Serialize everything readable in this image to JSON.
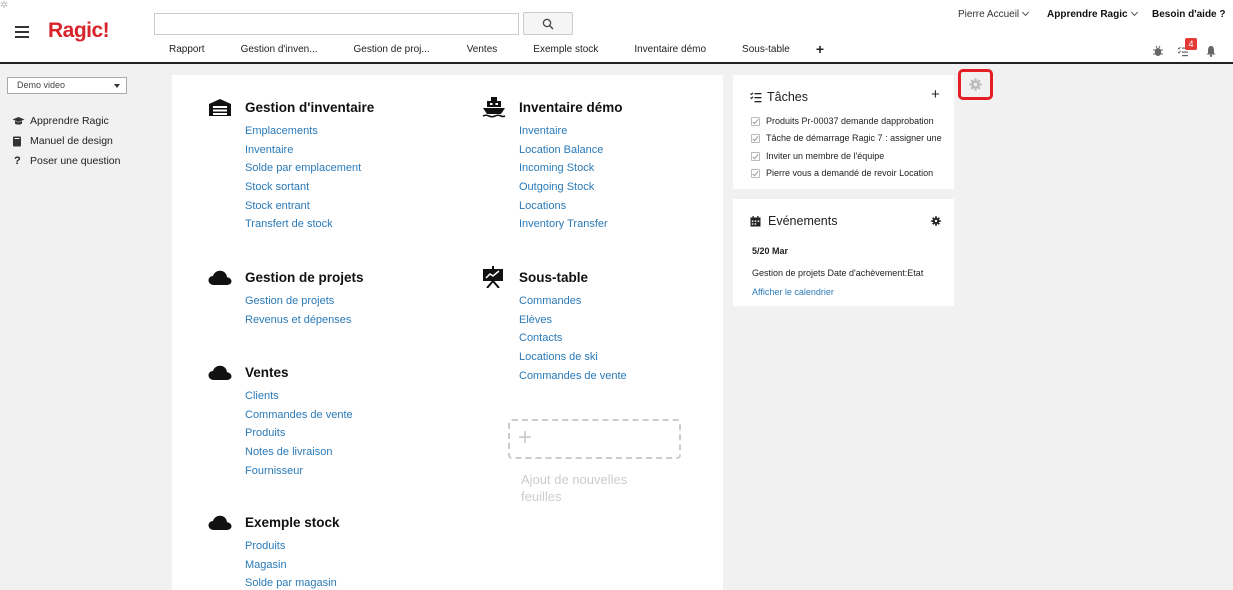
{
  "app": {
    "logo": "Ragic!"
  },
  "search": {
    "placeholder": ""
  },
  "nav_tabs": [
    "Rapport",
    "Gestion d'inven...",
    "Gestion de proj...",
    "Ventes",
    "Exemple stock",
    "Inventaire démo",
    "Sous-table"
  ],
  "nav_add": "+",
  "user_menu": {
    "account": "Pierre Accueil",
    "learn": "Apprendre Ragic",
    "help": "Besoin d'aide ?"
  },
  "notifications": {
    "todo_count": "4"
  },
  "sidebar": {
    "db_select": "Demo video",
    "links": [
      "Apprendre Ragic",
      "Manuel de design",
      "Poser une question"
    ]
  },
  "groups": [
    {
      "title": "Gestion d'inventaire",
      "items": [
        "Emplacements",
        "Inventaire",
        "Solde par emplacement",
        "Stock sortant",
        "Stock entrant",
        "Transfert de stock"
      ]
    },
    {
      "title": "Gestion de projets",
      "items": [
        "Gestion de projets",
        "Revenus et dépenses"
      ]
    },
    {
      "title": "Ventes",
      "items": [
        "Clients",
        "Commandes de vente",
        "Produits",
        "Notes de livraison",
        "Fournisseur"
      ]
    },
    {
      "title": "Exemple stock",
      "items": [
        "Produits",
        "Magasin",
        "Solde par magasin"
      ]
    },
    {
      "title": "Inventaire démo",
      "items": [
        "Inventaire",
        "Location Balance",
        "Incoming Stock",
        "Outgoing Stock",
        "Locations",
        "Inventory Transfer"
      ]
    },
    {
      "title": "Sous-table",
      "items": [
        "Commandes",
        "Elèves",
        "Contacts",
        "Locations de ski",
        "Commandes de vente"
      ]
    }
  ],
  "add_sheet": {
    "label": "Ajout de nouvelles feuilles"
  },
  "tasks": {
    "title": "Tâches",
    "items": [
      "Produits Pr-00037 demande dapprobation",
      "Tâche de démarrage Ragic 7 : assigner une",
      "Inviter un membre de l'équipe",
      "Pierre vous a demandé de revoir Location"
    ]
  },
  "events": {
    "title": "Evénements",
    "date": "5/20 Mar",
    "item": "Gestion de projets Date d'achèvement:Etat",
    "link": "Afficher le calendrier"
  },
  "colors": {
    "brand": "#d8232a",
    "link": "#2a7ab8",
    "highlight": "#e31e24"
  }
}
